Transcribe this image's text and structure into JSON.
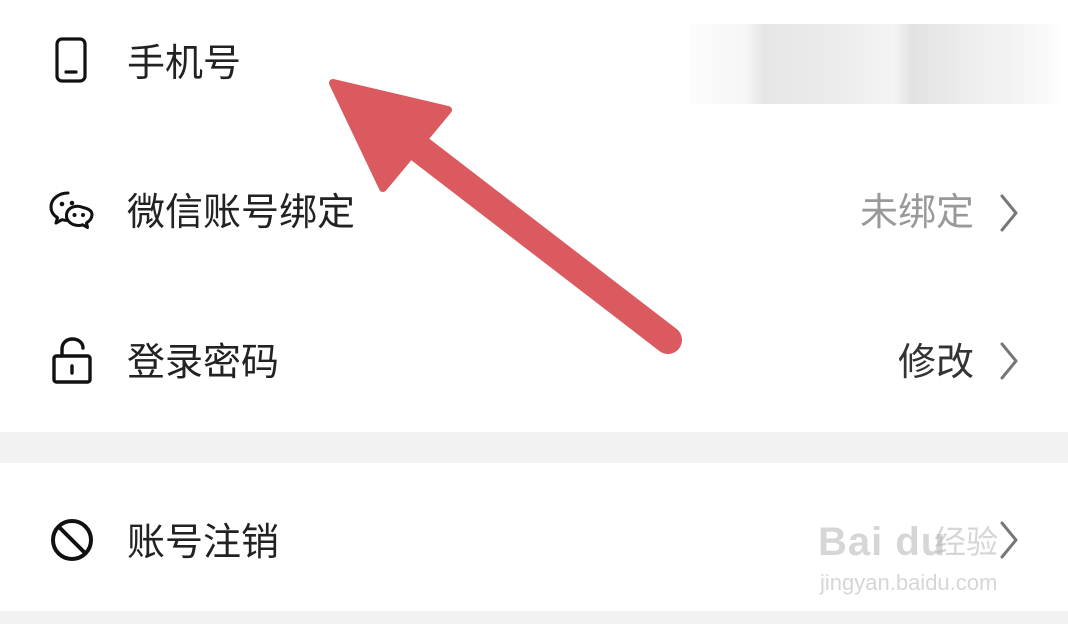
{
  "settings": {
    "rows": [
      {
        "label": "手机号",
        "icon": "phone-icon",
        "value": ""
      },
      {
        "label": "微信账号绑定",
        "icon": "wechat-icon",
        "value": "未绑定"
      },
      {
        "label": "登录密码",
        "icon": "unlock-icon",
        "value": "修改"
      },
      {
        "label": "账号注销",
        "icon": "ban-icon",
        "value": ""
      }
    ]
  },
  "colors": {
    "label": "#222222",
    "value_muted": "#999999",
    "value_strong": "#333333",
    "section_gap": "#f2f2f2",
    "arrow": "#da5a5f"
  },
  "watermark": {
    "logo": "Bai du",
    "text": "经验",
    "url": "jingyan.baidu.com"
  }
}
